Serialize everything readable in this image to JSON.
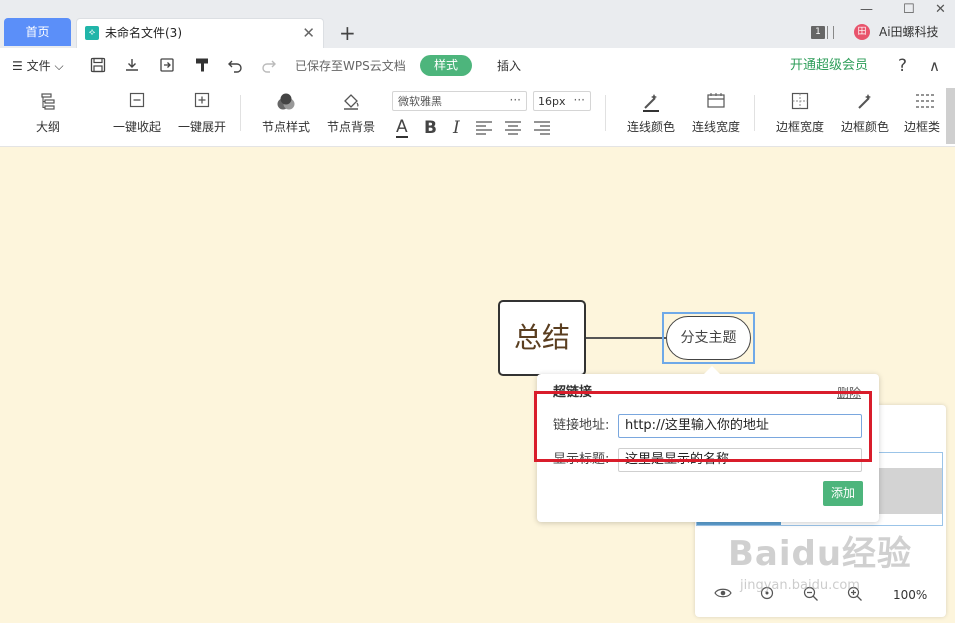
{
  "tabbar": {
    "home_tab": "首页",
    "doc_tab_title": "未命名文件(3)",
    "close_glyph": "✕",
    "add_glyph": "+",
    "window": {
      "minimize": "—",
      "maximize": "☐",
      "close": "✕"
    },
    "page_count": "1",
    "user_name": "Ai田螺科技",
    "avatar_glyph": "田"
  },
  "menubar": {
    "file_label": "文件",
    "saved_status": "已保存至WPS云文档",
    "style_tab": "样式",
    "insert_tab": "插入",
    "vip_link": "开通超级会员",
    "help_glyph": "?",
    "collapse_glyph": "∧"
  },
  "ribbon": {
    "outline": "大纲",
    "collapse_all": "一键收起",
    "expand_all": "一键展开",
    "node_style": "节点样式",
    "node_background": "节点背景",
    "font_name": "微软雅黑",
    "font_size": "16px",
    "dots": "···",
    "line_color": "连线颜色",
    "line_width": "连线宽度",
    "border_width": "边框宽度",
    "border_color": "边框颜色",
    "border_type": "边框类"
  },
  "canvas": {
    "main_topic": "总结",
    "sub_topic": "分支主题"
  },
  "hyperlink_dialog": {
    "title": "超链接",
    "delete": "删除",
    "url_label": "链接地址:",
    "url_value": "http://这里输入你的地址",
    "display_label": "显示标题:",
    "display_value": "这里是显示的名称",
    "add_button": "添加"
  },
  "zoom": {
    "value": "100%"
  },
  "watermark": {
    "brand": "Baidu经验",
    "url": "jingyan.baidu.com"
  },
  "colors": {
    "accent_green": "#4db57c",
    "home_blue": "#5b8ff9",
    "highlight_red": "#d91d2b",
    "canvas_bg": "#fdf5dc"
  }
}
